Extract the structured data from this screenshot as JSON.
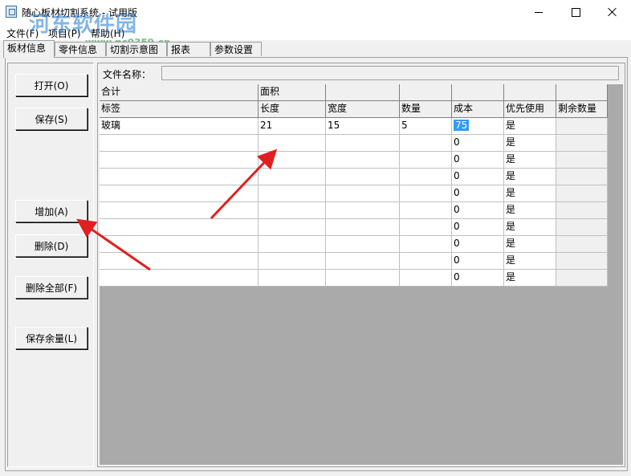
{
  "window": {
    "title": "随心板材切割系统 - 试用版"
  },
  "watermark": {
    "text": "河东软件园",
    "url": "www.pc0359.cn"
  },
  "menu": [
    "文件(F)",
    "项目(P)",
    "帮助(H)"
  ],
  "tabs": [
    "板材信息",
    "零件信息",
    "切割示意图",
    "报表",
    "参数设置"
  ],
  "buttons": {
    "open": "打开(O)",
    "save": "保存(S)",
    "add": "增加(A)",
    "delete": "删除(D)",
    "delete_all": "删除全部(F)",
    "save_remainder": "保存余量(L)"
  },
  "file": {
    "label": "文件名称：",
    "value": ""
  },
  "grid": {
    "summary_row": [
      "合计",
      "面积",
      "",
      "",
      "",
      "",
      ""
    ],
    "columns": [
      "标签",
      "长度",
      "宽度",
      "数量",
      "成本",
      "优先使用",
      "剩余数量"
    ],
    "rows": [
      [
        "玻璃",
        "21",
        "15",
        "5",
        "75",
        "是",
        ""
      ],
      [
        "",
        "",
        "",
        "",
        "0",
        "是",
        ""
      ],
      [
        "",
        "",
        "",
        "",
        "0",
        "是",
        ""
      ],
      [
        "",
        "",
        "",
        "",
        "0",
        "是",
        ""
      ],
      [
        "",
        "",
        "",
        "",
        "0",
        "是",
        ""
      ],
      [
        "",
        "",
        "",
        "",
        "0",
        "是",
        ""
      ],
      [
        "",
        "",
        "",
        "",
        "0",
        "是",
        ""
      ],
      [
        "",
        "",
        "",
        "",
        "0",
        "是",
        ""
      ],
      [
        "",
        "",
        "",
        "",
        "0",
        "是",
        ""
      ],
      [
        "",
        "",
        "",
        "",
        "0",
        "是",
        ""
      ]
    ]
  },
  "colors": {
    "annotation_arrow": "#e02020",
    "selection": "#3399ff"
  }
}
